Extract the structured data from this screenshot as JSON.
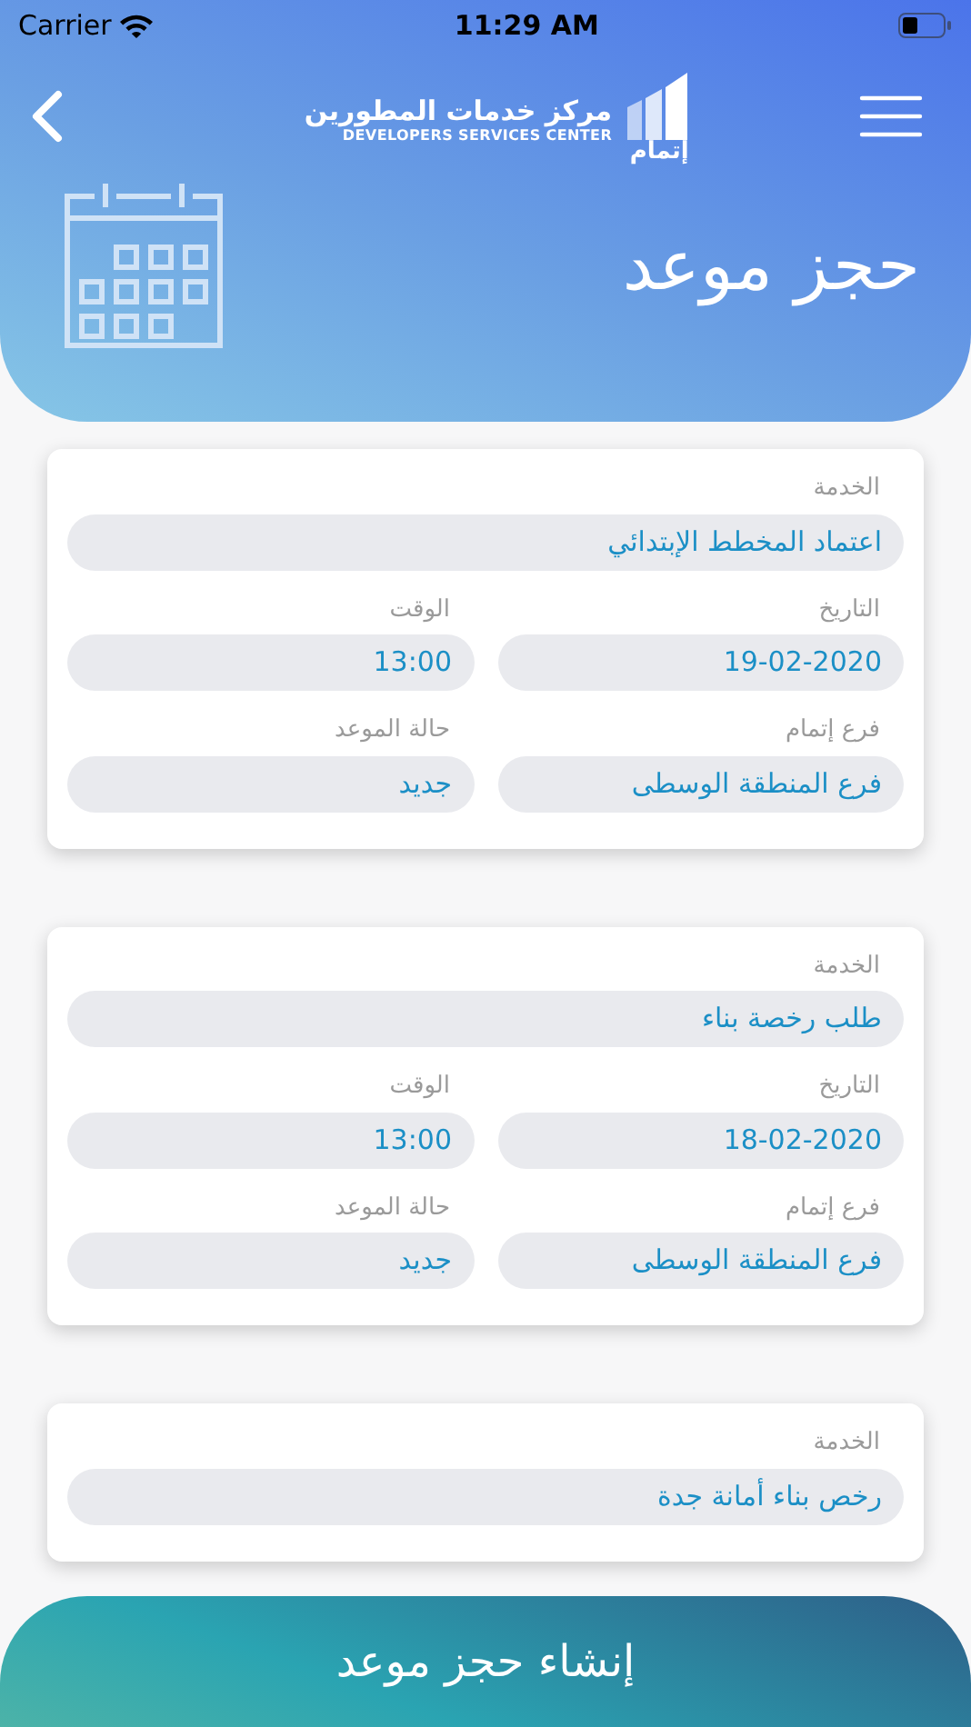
{
  "status_bar": {
    "carrier": "Carrier",
    "time": "11:29 AM"
  },
  "header": {
    "logo_word": "إتمام",
    "logo_title": "مركز خدمات المطورين",
    "logo_subtitle": "DEVELOPERS SERVICES CENTER",
    "page_title": "حجز موعد"
  },
  "appointments": [
    {
      "fields": [
        {
          "kind": "full",
          "label": "الخدمة",
          "value": "اعتماد المخطط الإبتدائي"
        },
        {
          "kind": "half",
          "label": "التاريخ",
          "value": "19-02-2020"
        },
        {
          "kind": "half",
          "label": "الوقت",
          "value": "13:00"
        },
        {
          "kind": "half",
          "label": "فرع إتمام",
          "value": "فرع المنطقة الوسطى"
        },
        {
          "kind": "half",
          "label": "حالة الموعد",
          "value": "جديد"
        }
      ]
    },
    {
      "fields": [
        {
          "kind": "full",
          "label": "الخدمة",
          "value": "طلب رخصة بناء"
        },
        {
          "kind": "half",
          "label": "التاريخ",
          "value": "18-02-2020"
        },
        {
          "kind": "half",
          "label": "الوقت",
          "value": "13:00"
        },
        {
          "kind": "half",
          "label": "فرع إتمام",
          "value": "فرع المنطقة الوسطى"
        },
        {
          "kind": "half",
          "label": "حالة الموعد",
          "value": "جديد"
        }
      ]
    },
    {
      "fields": [
        {
          "kind": "full",
          "label": "الخدمة",
          "value": "رخص بناء أمانة جدة"
        }
      ]
    }
  ],
  "create_button": {
    "label": "إنشاء حجز موعد"
  }
}
